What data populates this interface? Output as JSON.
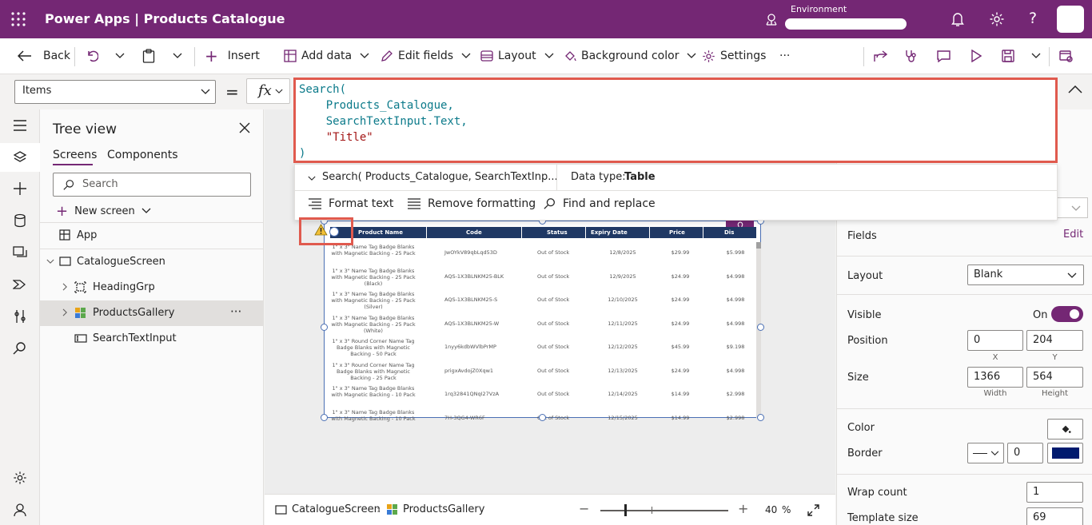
{
  "header": {
    "title": "Power Apps | Products Catalogue",
    "environment_label": "Environment"
  },
  "cmdbar": {
    "back": "Back",
    "insert": "Insert",
    "add_data": "Add data",
    "edit_fields": "Edit fields",
    "layout": "Layout",
    "background_color": "Background color",
    "settings": "Settings",
    "more": "···"
  },
  "formula": {
    "property": "Items",
    "equals": "=",
    "fx": "fx",
    "lines": [
      "Search(",
      "    Products_Catalogue,",
      "    SearchTextInput.Text,",
      "    \"Title\"",
      ")"
    ],
    "preview": "Search( Products_Catalogue, SearchTextInp...",
    "data_type_label": "Data type:",
    "data_type_value": "Table",
    "format_text": "Format text",
    "remove_formatting": "Remove formatting",
    "find_replace": "Find and replace"
  },
  "tree": {
    "title": "Tree view",
    "tab_screens": "Screens",
    "tab_components": "Components",
    "search_placeholder": "Search",
    "new_screen": "New screen",
    "items": [
      "App",
      "CatalogueScreen",
      "HeadingGrp",
      "ProductsGallery",
      "SearchTextInput"
    ],
    "more": "···"
  },
  "gallery": {
    "columns": [
      "Product Name",
      "Code",
      "Status",
      "Expiry Date",
      "Price",
      "Dis"
    ],
    "rows": [
      [
        "1\" x 3\" Name Tag Badge Blanks with Magnetic Backing - 25 Pack",
        "JwOYkV89qbLqd53D",
        "Out of Stock",
        "12/8/2025",
        "$29.99",
        "$5.998"
      ],
      [
        "1\" x 3\" Name Tag Badge Blanks with Magnetic Backing - 25 Pack (Black)",
        "AQS-1X3BLNKM25-BLK",
        "Out of Stock",
        "12/9/2025",
        "$24.99",
        "$4.998"
      ],
      [
        "1\" x 3\" Name Tag Badge Blanks with Magnetic Backing - 25 Pack (Silver)",
        "AQS-1X3BLNKM25-S",
        "Out of Stock",
        "12/10/2025",
        "$24.99",
        "$4.998"
      ],
      [
        "1\" x 3\" Name Tag Badge Blanks with Magnetic Backing - 25 Pack (White)",
        "AQS-1X3BLNKM25-W",
        "Out of Stock",
        "12/11/2025",
        "$24.99",
        "$4.998"
      ],
      [
        "1\" x 3\" Round Corner Name Tag Badge Blanks with Magnetic Backing - 50 Pack",
        "1nyy6kdbWVlbPrMP",
        "Out of Stock",
        "12/12/2025",
        "$45.99",
        "$9.198"
      ],
      [
        "1\" x 3\" Round Corner Name Tag Badge Blanks with Magnetic Backing - 25 Pack",
        "prigxAvdojZ0Xqw1",
        "Out of Stock",
        "12/13/2025",
        "$24.99",
        "$4.998"
      ],
      [
        "1\" x 3\" Name Tag Badge Blanks with Magnetic Backing - 10 Pack",
        "1rq32841QNqI27VzA",
        "Out of Stock",
        "12/14/2025",
        "$14.99",
        "$2.998"
      ],
      [
        "1\" x 3\" Name Tag Badge Blanks with Magnetic Backing - 10 Pack",
        "7H-3QG4-WR6F",
        "Out of Stock",
        "12/15/2025",
        "$14.99",
        "$2.998"
      ]
    ]
  },
  "statusbar": {
    "screen": "CatalogueScreen",
    "control": "ProductsGallery",
    "zoom": "40",
    "zoom_unit": "%"
  },
  "props": {
    "fields_label": "Fields",
    "fields_edit": "Edit",
    "layout_label": "Layout",
    "layout_value": "Blank",
    "visible_label": "Visible",
    "visible_value": "On",
    "position_label": "Position",
    "position_x": "0",
    "position_y": "204",
    "x_label": "X",
    "y_label": "Y",
    "size_label": "Size",
    "width": "1366",
    "height": "564",
    "width_label": "Width",
    "height_label": "Height",
    "color_label": "Color",
    "border_label": "Border",
    "border_width": "0",
    "wrap_label": "Wrap count",
    "wrap_value": "1",
    "template_label": "Template size",
    "template_value": "69"
  },
  "colors": {
    "brand": "#742774",
    "highlight": "#e05a4e",
    "gallery_header": "#1f3864",
    "border_color": "#001a6e"
  }
}
